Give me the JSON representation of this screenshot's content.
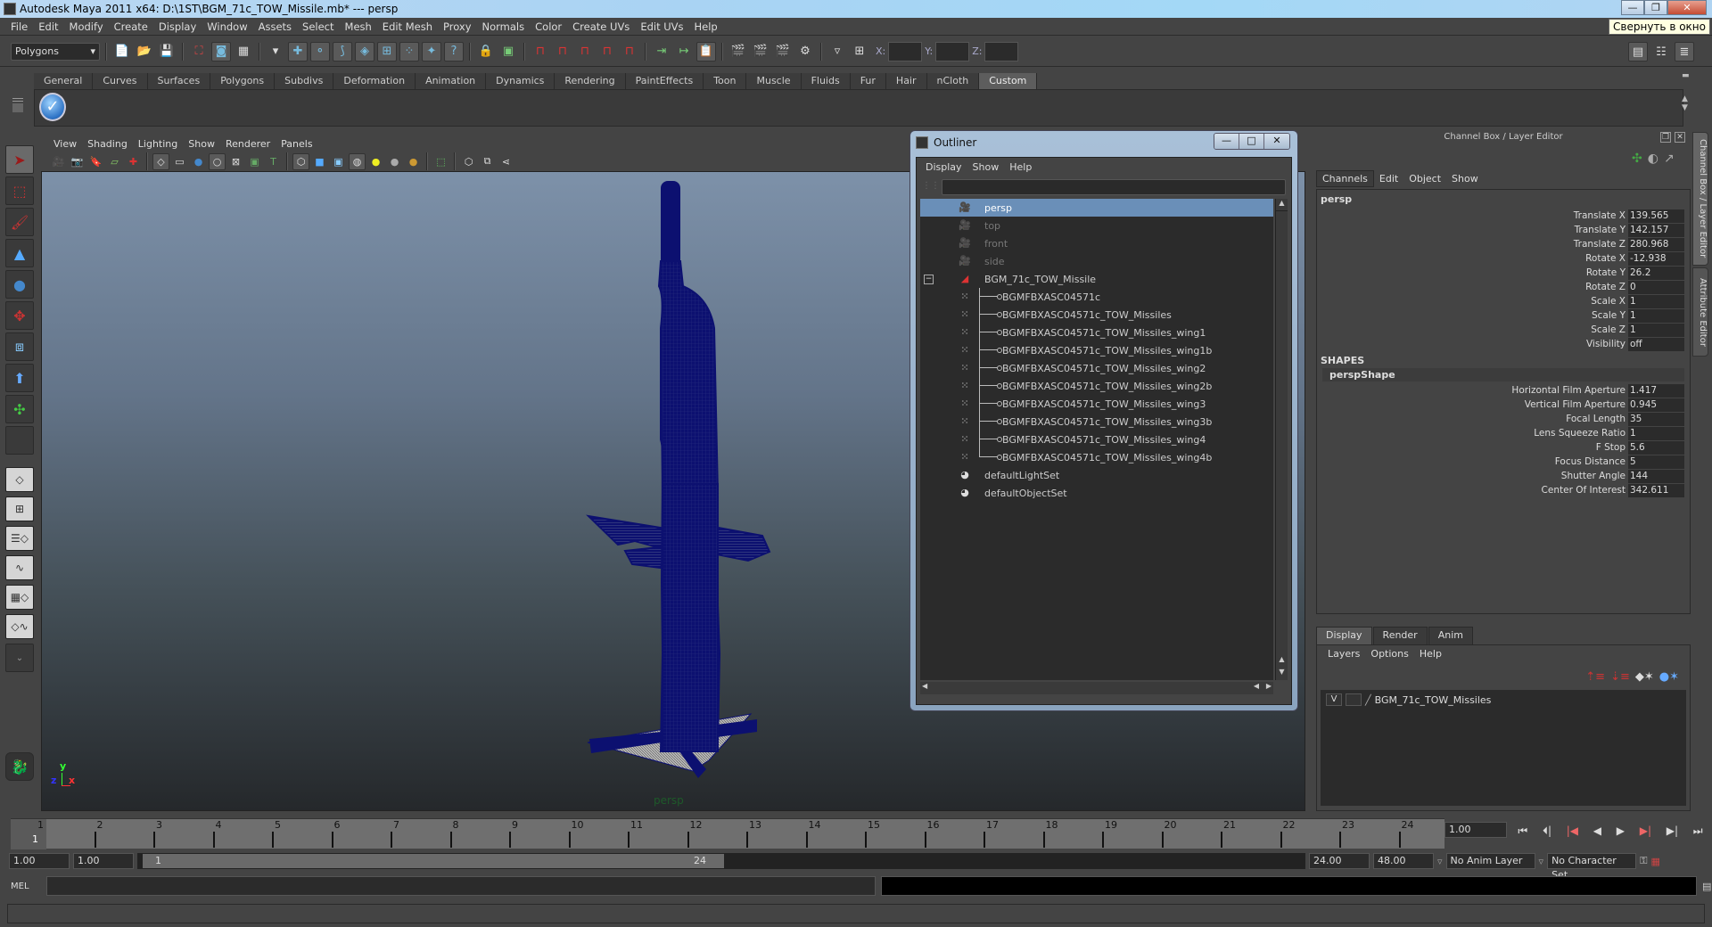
{
  "window": {
    "title": "Autodesk Maya 2011 x64: D:\\1ST\\BGM_71c_TOW_Missile.mb*  ---  persp",
    "tooltip": "Свернуть в окно",
    "buttons": {
      "minimize": "—",
      "restore": "❐",
      "close": "✕"
    }
  },
  "menubar": [
    "File",
    "Edit",
    "Modify",
    "Create",
    "Display",
    "Window",
    "Assets",
    "Select",
    "Mesh",
    "Edit Mesh",
    "Proxy",
    "Normals",
    "Color",
    "Create UVs",
    "Edit UVs",
    "Help"
  ],
  "statusline": {
    "mode": "Polygons",
    "coord_labels": {
      "x": "X:",
      "y": "Y:",
      "z": "Z:"
    },
    "icons": [
      "new-scene-icon",
      "open-scene-icon",
      "save-scene-icon",
      "select-hierarchy-icon",
      "select-object-icon",
      "select-component-icon",
      "lock-selection-icon",
      "highlight-selection-icon",
      "snap-grid-icon",
      "snap-curve-icon",
      "snap-point-icon",
      "snap-view-plane-icon",
      "make-live-icon",
      "input-ops-icon",
      "output-ops-icon",
      "construction-history-icon",
      "render-view-icon",
      "render-icon",
      "ipr-render-icon",
      "render-settings-icon"
    ]
  },
  "shelf": {
    "tabs": [
      "General",
      "Curves",
      "Surfaces",
      "Polygons",
      "Subdivs",
      "Deformation",
      "Animation",
      "Dynamics",
      "Rendering",
      "PaintEffects",
      "Toon",
      "Muscle",
      "Fluids",
      "Fur",
      "Hair",
      "nCloth",
      "Custom"
    ],
    "active_tab": "Custom"
  },
  "viewport": {
    "menus": [
      "View",
      "Shading",
      "Lighting",
      "Show",
      "Renderer",
      "Panels"
    ],
    "camera_label": "persp",
    "axis": {
      "x": "x",
      "y": "y",
      "z": "z"
    },
    "model_color": "#0c1070"
  },
  "outliner": {
    "title": "Outliner",
    "menus": [
      "Display",
      "Show",
      "Help"
    ],
    "search_value": "",
    "items": [
      {
        "label": "persp",
        "icon": "camera-icon",
        "state": "selected",
        "level": 0
      },
      {
        "label": "top",
        "icon": "camera-icon",
        "state": "dim",
        "level": 0
      },
      {
        "label": "front",
        "icon": "camera-icon",
        "state": "dim",
        "level": 0
      },
      {
        "label": "side",
        "icon": "camera-icon",
        "state": "dim",
        "level": 0
      },
      {
        "label": "BGM_71c_TOW_Missile",
        "icon": "group-icon",
        "state": "expanded",
        "level": 0
      },
      {
        "label": "BGMFBXASC04571c",
        "icon": "mesh-icon",
        "state": "normal",
        "level": 1
      },
      {
        "label": "BGMFBXASC04571c_TOW_Missiles",
        "icon": "mesh-icon",
        "state": "normal",
        "level": 1
      },
      {
        "label": "BGMFBXASC04571c_TOW_Missiles_wing1",
        "icon": "mesh-icon",
        "state": "normal",
        "level": 1
      },
      {
        "label": "BGMFBXASC04571c_TOW_Missiles_wing1b",
        "icon": "mesh-icon",
        "state": "normal",
        "level": 1
      },
      {
        "label": "BGMFBXASC04571c_TOW_Missiles_wing2",
        "icon": "mesh-icon",
        "state": "normal",
        "level": 1
      },
      {
        "label": "BGMFBXASC04571c_TOW_Missiles_wing2b",
        "icon": "mesh-icon",
        "state": "normal",
        "level": 1
      },
      {
        "label": "BGMFBXASC04571c_TOW_Missiles_wing3",
        "icon": "mesh-icon",
        "state": "normal",
        "level": 1
      },
      {
        "label": "BGMFBXASC04571c_TOW_Missiles_wing3b",
        "icon": "mesh-icon",
        "state": "normal",
        "level": 1
      },
      {
        "label": "BGMFBXASC04571c_TOW_Missiles_wing4",
        "icon": "mesh-icon",
        "state": "normal",
        "level": 1
      },
      {
        "label": "BGMFBXASC04571c_TOW_Missiles_wing4b",
        "icon": "mesh-icon",
        "state": "normal",
        "level": 1
      },
      {
        "label": "defaultLightSet",
        "icon": "set-icon",
        "state": "normal",
        "level": 0
      },
      {
        "label": "defaultObjectSet",
        "icon": "set-icon",
        "state": "normal",
        "level": 0
      }
    ]
  },
  "channelbox": {
    "header": "Channel Box / Layer Editor",
    "tabs": [
      "Channels",
      "Edit",
      "Object",
      "Show"
    ],
    "object": "persp",
    "channels": [
      {
        "label": "Translate X",
        "value": "139.565"
      },
      {
        "label": "Translate Y",
        "value": "142.157"
      },
      {
        "label": "Translate Z",
        "value": "280.968"
      },
      {
        "label": "Rotate X",
        "value": "-12.938"
      },
      {
        "label": "Rotate Y",
        "value": "26.2"
      },
      {
        "label": "Rotate Z",
        "value": "0"
      },
      {
        "label": "Scale X",
        "value": "1"
      },
      {
        "label": "Scale Y",
        "value": "1"
      },
      {
        "label": "Scale Z",
        "value": "1"
      },
      {
        "label": "Visibility",
        "value": "off"
      }
    ],
    "shapes_header": "SHAPES",
    "shape_name": "perspShape",
    "shape_channels": [
      {
        "label": "Horizontal Film Aperture",
        "value": "1.417"
      },
      {
        "label": "Vertical Film Aperture",
        "value": "0.945"
      },
      {
        "label": "Focal Length",
        "value": "35"
      },
      {
        "label": "Lens Squeeze Ratio",
        "value": "1"
      },
      {
        "label": "F Stop",
        "value": "5.6"
      },
      {
        "label": "Focus Distance",
        "value": "5"
      },
      {
        "label": "Shutter Angle",
        "value": "144"
      },
      {
        "label": "Center Of Interest",
        "value": "342.611"
      }
    ],
    "side_tabs": [
      "Channel Box / Layer Editor",
      "Attribute Editor"
    ]
  },
  "layereditor": {
    "tabs": [
      "Display",
      "Render",
      "Anim"
    ],
    "active_tab": "Display",
    "menus": [
      "Layers",
      "Options",
      "Help"
    ],
    "layers": [
      {
        "visible": "V",
        "name": "BGM_71c_TOW_Missiles"
      }
    ]
  },
  "timeline": {
    "ticks": [
      "1",
      "2",
      "3",
      "4",
      "5",
      "6",
      "7",
      "8",
      "9",
      "10",
      "11",
      "12",
      "13",
      "14",
      "15",
      "16",
      "17",
      "18",
      "19",
      "20",
      "21",
      "22",
      "23",
      "24"
    ],
    "current_marker": "1",
    "current_frame": "1.00"
  },
  "range": {
    "start_time": "1.00",
    "playback_start": "1.00",
    "slider_start": "1",
    "slider_end": "24",
    "playback_end": "24.00",
    "end_time": "48.00",
    "anim_layer": "No Anim Layer",
    "character_set": "No Character Set"
  },
  "mel": {
    "label": "MEL",
    "input": "",
    "output": ""
  }
}
